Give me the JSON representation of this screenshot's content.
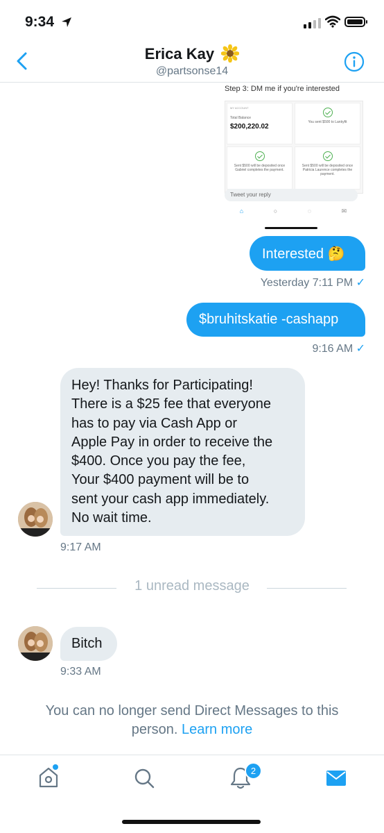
{
  "status_bar": {
    "time": "9:34"
  },
  "header": {
    "name": "Erica Kay",
    "handle": "@partsonse14"
  },
  "embed": {
    "caption": "Step 3: DM me if you're interested",
    "account_label": "MY ACCOUNT",
    "balance_label": "Total Balance",
    "balance": "$200,220.02",
    "cell_sent": "You sent $500 to Lankyfit",
    "cell_gabriel": "Sent $500 will be deposited once Gabriel completes the payment.",
    "cell_patricia": "Sent $500 will be deposited once Patricia Laurence completes the payment.",
    "reply_placeholder": "Tweet your reply"
  },
  "messages": {
    "out1": {
      "text": "Interested 🤔",
      "time": "Yesterday 7:11 PM"
    },
    "out2": {
      "text": "$bruhitskatie -cashapp",
      "time": "9:16 AM"
    },
    "in1": {
      "lines": [
        "Hey! Thanks for Participating!",
        "There is a $25 fee that everyone",
        "has to pay via Cash App or",
        "Apple Pay in order to receive the",
        "$400. Once you pay the fee,",
        "Your $400 payment will be to",
        "sent your cash app immediately.",
        "No wait time."
      ],
      "time": "9:17 AM"
    },
    "unread": "1 unread message",
    "in2": {
      "text": "Bitch",
      "time": "9:33 AM"
    }
  },
  "notice": {
    "text": "You can no longer send Direct Messages to this person.",
    "link": "Learn more"
  },
  "tabbar": {
    "notifications_badge": "2"
  },
  "colors": {
    "accent": "#1da1f2",
    "incoming_bubble": "#e6ecf0",
    "meta_text": "#657786"
  }
}
